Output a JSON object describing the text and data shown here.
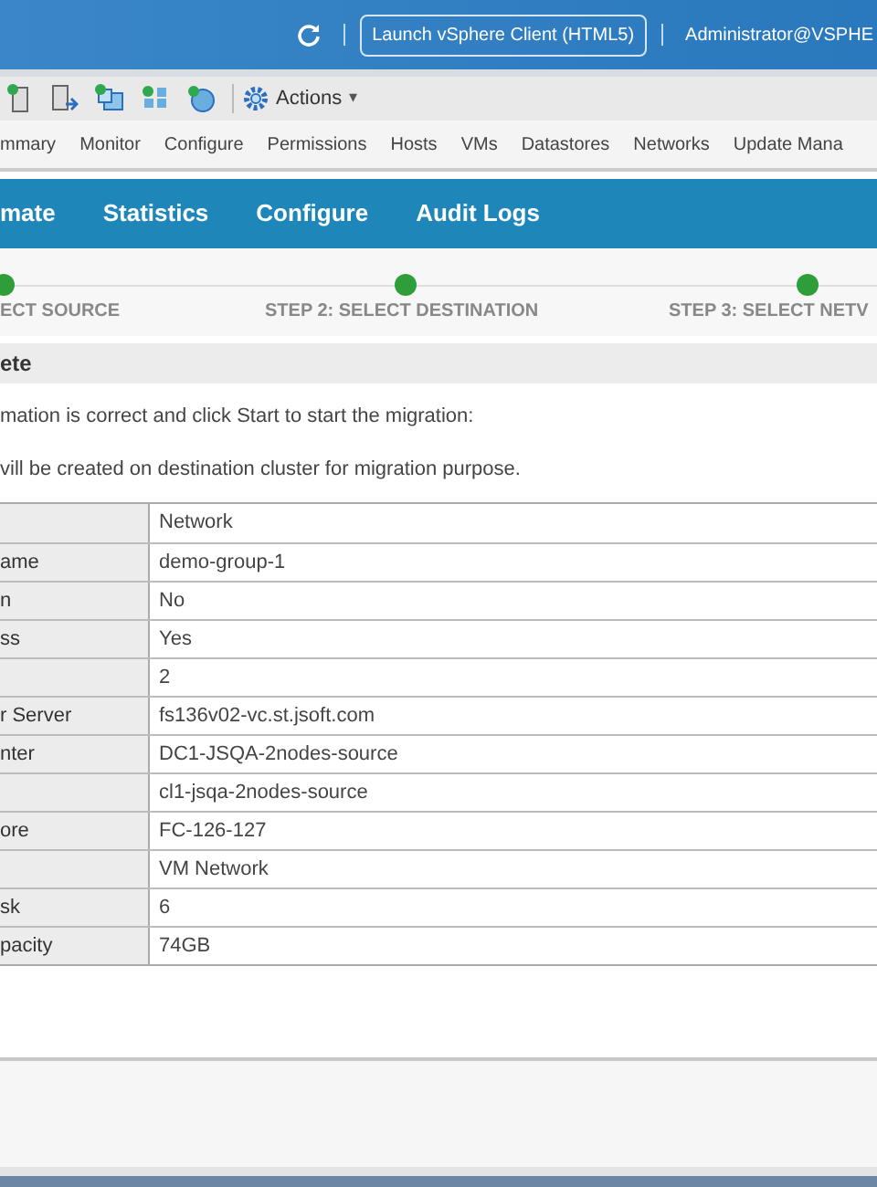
{
  "header": {
    "launch_button": "Launch vSphere Client (HTML5)",
    "user": "Administrator@VSPHE"
  },
  "toolbar": {
    "actions": "Actions",
    "caret": "▾"
  },
  "nav_tabs": [
    {
      "label": "mmary",
      "selected": false
    },
    {
      "label": "Monitor",
      "selected": false
    },
    {
      "label": "Configure",
      "selected": false
    },
    {
      "label": "Permissions",
      "selected": false
    },
    {
      "label": "Hosts",
      "selected": false
    },
    {
      "label": "VMs",
      "selected": false
    },
    {
      "label": "Datastores",
      "selected": false
    },
    {
      "label": "Networks",
      "selected": false
    },
    {
      "label": "Update Mana",
      "selected": false
    }
  ],
  "plugin_tabs": [
    {
      "label": "mate"
    },
    {
      "label": "Statistics"
    },
    {
      "label": "Configure"
    },
    {
      "label": "Audit Logs"
    }
  ],
  "steps": [
    {
      "label": "ECT SOURCE",
      "done": true
    },
    {
      "label": "STEP 2: SELECT DESTINATION",
      "done": true
    },
    {
      "label": "STEP 3: SELECT NETV",
      "done": true
    }
  ],
  "section_title": "ete",
  "messages": [
    "mation is correct and click Start to start the migration:",
    "vill be created on destination cluster for migration purpose."
  ],
  "table": {
    "rows": [
      {
        "value": "Network"
      },
      {
        "label": "ame",
        "value": "demo-group-1"
      },
      {
        "label": "n",
        "value": "No"
      },
      {
        "label": "ss",
        "value": "Yes"
      },
      {
        "value": "2"
      },
      {
        "label": "r Server",
        "value": "fs136v02-vc.st.jsoft.com"
      },
      {
        "label": "nter",
        "value": "DC1-JSQA-2nodes-source"
      },
      {
        "value": "cl1-jsqa-2nodes-source"
      },
      {
        "label": "ore",
        "value": "FC-126-127"
      },
      {
        "value": "VM Network"
      },
      {
        "label": "sk",
        "value": "6"
      },
      {
        "label": "pacity",
        "value": "74GB"
      }
    ]
  }
}
